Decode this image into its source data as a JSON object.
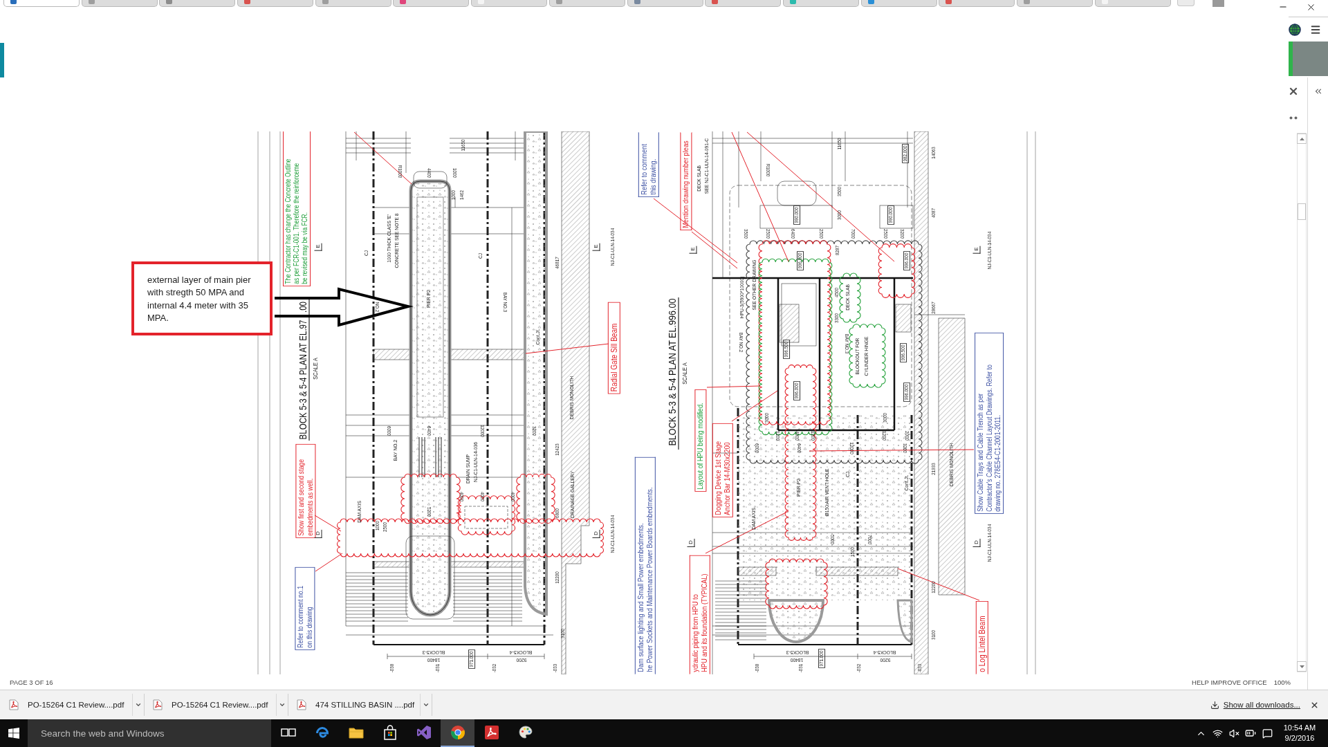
{
  "browser": {
    "tabs": [
      {
        "selected": true,
        "color": "#2a6ebb"
      },
      {
        "selected": false,
        "color": "#9e9e9e"
      },
      {
        "selected": false,
        "color": "#8d8d8d"
      },
      {
        "selected": false,
        "color": "#d9534f"
      },
      {
        "selected": false,
        "color": "#9e9e9e"
      },
      {
        "selected": false,
        "color": "#e0457b"
      },
      {
        "selected": false,
        "color": "#f4f4f4"
      },
      {
        "selected": false,
        "color": "#9e9e9e"
      },
      {
        "selected": false,
        "color": "#7a8aa0"
      },
      {
        "selected": false,
        "color": "#d9534f"
      },
      {
        "selected": false,
        "color": "#2bbbad"
      },
      {
        "selected": false,
        "color": "#2a8fd6"
      },
      {
        "selected": false,
        "color": "#d9534f"
      },
      {
        "selected": false,
        "color": "#9e9e9e"
      },
      {
        "selected": false,
        "color": "#f4f4f4"
      }
    ]
  },
  "viewer": {
    "callout": "external layer of main pier with stregth 50 MPA and internal 4.4 meter with 35 MPA.",
    "drawing": {
      "plans": [
        {
          "title": "BLOCK 5-3 & 5-4 PLAN AT EL.97",
          "title_tail": ".00",
          "scale": "SCALE A",
          "comments": [
            {
              "kind": "flagged",
              "color": "#1f9e3a",
              "lines": [
                "The Contractor has change the Concrete Outline",
                "as per FCR-C1-001. Therefore the reinforceme",
                "be revised may be via FCR."
              ]
            },
            {
              "kind": "note",
              "color": "#e3232b",
              "lines": [
                "Show first and second stage",
                "embedments as well."
              ]
            },
            {
              "kind": "note",
              "color": "#3d51a3",
              "lines": [
                "Refer to comment no.1",
                "on this drawing"
              ]
            },
            {
              "kind": "note",
              "color": "#e3232b",
              "lines": [
                "Radial Gate Sill Beam"
              ]
            }
          ],
          "labels": [
            {
              "text": "11650",
              "kind": "dimension"
            },
            {
              "text": "R1000",
              "kind": "inverted"
            },
            {
              "text": "4400",
              "kind": "inverted"
            },
            {
              "text": "1000",
              "kind": "inverted"
            },
            {
              "text": "1000",
              "kind": "dimension"
            },
            {
              "text": "1462",
              "kind": "dimension"
            },
            {
              "text": "1000 THICK CLASS 'E'",
              "kind": "note"
            },
            {
              "text": "CONCRETE SEE NOTE 8",
              "kind": "note"
            },
            {
              "text": "CJ",
              "kind": "note"
            },
            {
              "text": "CJ",
              "kind": "note"
            },
            {
              "text": "46817",
              "kind": "dimension"
            },
            {
              "text": "NO.2",
              "kind": "inverted"
            },
            {
              "text": "PIER P2",
              "kind": "note"
            },
            {
              "text": "BAY NO.3",
              "kind": "inverted"
            },
            {
              "text": "Cont.Jt.",
              "kind": "note"
            },
            {
              "text": "DEBRIS MONOLITH",
              "kind": "note"
            },
            {
              "text": "6000",
              "kind": "inverted"
            },
            {
              "text": "6400",
              "kind": "inverted"
            },
            {
              "text": "12000",
              "kind": "inverted"
            },
            {
              "text": "3200",
              "kind": "inverted"
            },
            {
              "text": "BAY NO.2",
              "kind": "note"
            },
            {
              "text": "12423",
              "kind": "dimension"
            },
            {
              "text": "DRAIN SUMP",
              "kind": "note"
            },
            {
              "text": "NJ-C1-ULN-14-036",
              "kind": "note"
            },
            {
              "text": "DRAINAGE GALLERY",
              "kind": "note"
            },
            {
              "text": "4000",
              "kind": "inverted"
            },
            {
              "text": "4000",
              "kind": "inverted"
            },
            {
              "text": "4000",
              "kind": "inverted"
            },
            {
              "text": "5200",
              "kind": "inverted"
            },
            {
              "text": "DAM AXIS",
              "kind": "note"
            },
            {
              "text": "1000",
              "kind": "dimension"
            },
            {
              "text": "2500",
              "kind": "dimension"
            },
            {
              "text": "6800",
              "kind": "dimension"
            },
            {
              "text": "12200",
              "kind": "dimension"
            },
            {
              "text": "3100",
              "kind": "dimension"
            },
            {
              "text": "BLOCK5-3",
              "kind": "reversed"
            },
            {
              "text": "18400",
              "kind": "reversed"
            },
            {
              "text": "BLOCK5-4",
              "kind": "reversed"
            },
            {
              "text": "9200",
              "kind": "reversed"
            },
            {
              "text": "971.000",
              "kind": "level"
            },
            {
              "text": "NJ-C1-ULN-14-034",
              "kind": "dimension"
            },
            {
              "text": "NJ-C1-ULN-14-034",
              "kind": "dimension"
            },
            {
              "text": "-038",
              "kind": "dimension"
            },
            {
              "text": "-031",
              "kind": "dimension"
            },
            {
              "text": "-032",
              "kind": "dimension"
            },
            {
              "text": "-033",
              "kind": "dimension"
            }
          ],
          "markers": [
            "E",
            "E",
            "D",
            "D"
          ]
        },
        {
          "title": "BLOCK 5-3 & 5-4 PLAN AT EL.996.00",
          "scale": "SCALE A",
          "comments": [
            {
              "kind": "note",
              "color": "#3d51a3",
              "lines": [
                "Refer to comment",
                "this drawing."
              ]
            },
            {
              "kind": "note",
              "color": "#e3232b",
              "lines": [
                "Mention drawing number pleas"
              ]
            },
            {
              "kind": "note",
              "color": "#3d51a3",
              "lines": [
                "Dam surface lighting and Small Power embedments.",
                "he Power Sockets and Maintenance Power Boards embedments."
              ]
            },
            {
              "kind": "flagged",
              "color": "#1f9e3a",
              "lines": [
                "Layout of HPU being modified."
              ]
            },
            {
              "kind": "note",
              "color": "#e3232b",
              "lines": [
                "Dogging Device 1st Stage",
                "Anchor Bar 14-M30x2200"
              ]
            },
            {
              "kind": "note",
              "color": "#e3232b",
              "lines": [
                "ydraulic piping from HPU to",
                "HPU and its foundation (TYPICAL)"
              ]
            },
            {
              "kind": "note",
              "color": "#3d51a3",
              "lines": [
                "Show Cable Trays and Cable Trench as per",
                "Contractor's Cable Channel Layout Drawings. Refer to",
                "drawing no. 278E54-C1-2001-2011."
              ]
            },
            {
              "kind": "note",
              "color": "#e3232b",
              "lines": [
                "o Log Lintel Beam"
              ]
            }
          ],
          "labels": [
            {
              "text": "11650",
              "kind": "dimension"
            },
            {
              "text": "R1000",
              "kind": "inverted"
            },
            {
              "text": "DECK SLAB",
              "kind": "note"
            },
            {
              "text": "SEE NJ-C1-ULN-14-091-C",
              "kind": "note"
            },
            {
              "text": "3500",
              "kind": "dimension"
            },
            {
              "text": "3000",
              "kind": "dimension"
            },
            {
              "text": "990.000",
              "kind": "level"
            },
            {
              "text": "990.000",
              "kind": "level"
            },
            {
              "text": "982.000",
              "kind": "level"
            },
            {
              "text": "14063",
              "kind": "dimension"
            },
            {
              "text": "4087",
              "kind": "dimension"
            },
            {
              "text": "3500",
              "kind": "inverted"
            },
            {
              "text": "2500",
              "kind": "inverted"
            },
            {
              "text": "6400",
              "kind": "inverted"
            },
            {
              "text": "2500",
              "kind": "inverted"
            },
            {
              "text": "7000",
              "kind": "inverted"
            },
            {
              "text": "2500",
              "kind": "inverted"
            },
            {
              "text": "3200",
              "kind": "inverted"
            },
            {
              "text": "8287",
              "kind": "dimension"
            },
            {
              "text": "996.000",
              "kind": "level"
            },
            {
              "text": "996.000",
              "kind": "level"
            },
            {
              "text": "HPU-3(5900*10000)",
              "kind": "note"
            },
            {
              "text": "SEE OTHER DRAWING",
              "kind": "note"
            },
            {
              "text": "DECK SLAB",
              "kind": "note"
            },
            {
              "text": "4500",
              "kind": "dimension"
            },
            {
              "text": "3300",
              "kind": "dimension"
            },
            {
              "text": "28667",
              "kind": "dimension"
            },
            {
              "text": "BAY NO.2",
              "kind": "inverted"
            },
            {
              "text": "996.500",
              "kind": "level"
            },
            {
              "text": "996.500",
              "kind": "level"
            },
            {
              "text": "BAY NO.3",
              "kind": "inverted"
            },
            {
              "text": "BLOCKOUT FOR",
              "kind": "note"
            },
            {
              "text": "CYLINDER HINGE",
              "kind": "note"
            },
            {
              "text": "996.000",
              "kind": "level"
            },
            {
              "text": "996.000",
              "kind": "level"
            },
            {
              "text": "3000",
              "kind": "dimension"
            },
            {
              "text": "3000",
              "kind": "dimension"
            },
            {
              "text": "1200",
              "kind": "inverted"
            },
            {
              "text": "4000",
              "kind": "inverted"
            },
            {
              "text": "1200",
              "kind": "inverted"
            },
            {
              "text": "1200",
              "kind": "inverted"
            },
            {
              "text": "2000",
              "kind": "inverted"
            },
            {
              "text": "6000",
              "kind": "inverted"
            },
            {
              "text": "6400",
              "kind": "inverted"
            },
            {
              "text": "12000",
              "kind": "inverted"
            },
            {
              "text": "3200",
              "kind": "inverted"
            },
            {
              "text": "DEBRIS MONOLITH",
              "kind": "note"
            },
            {
              "text": "21933",
              "kind": "dimension"
            },
            {
              "text": "CJ",
              "kind": "note"
            },
            {
              "text": "Cont.Jt.",
              "kind": "note"
            },
            {
              "text": "PIER P2",
              "kind": "note"
            },
            {
              "text": "Ø150 AIR VENT HOLE",
              "kind": "note"
            },
            {
              "text": "DAM AXIS",
              "kind": "note"
            },
            {
              "text": "5000",
              "kind": "inverted"
            },
            {
              "text": "7000",
              "kind": "inverted"
            },
            {
              "text": "1500",
              "kind": "dimension"
            },
            {
              "text": "12200",
              "kind": "dimension"
            },
            {
              "text": "3100",
              "kind": "dimension"
            },
            {
              "text": "BLOCK5-3",
              "kind": "reversed"
            },
            {
              "text": "18400",
              "kind": "reversed"
            },
            {
              "text": "971.000",
              "kind": "level"
            },
            {
              "text": "BLOCK5-4",
              "kind": "reversed"
            },
            {
              "text": "9200",
              "kind": "reversed"
            },
            {
              "text": "NJ-C1-ULN-14-034",
              "kind": "dimension"
            },
            {
              "text": "NJ-C1-ULN-14-034",
              "kind": "dimension"
            },
            {
              "text": "-038",
              "kind": "dimension"
            },
            {
              "text": "-031",
              "kind": "dimension"
            },
            {
              "text": "-032",
              "kind": "dimension"
            },
            {
              "text": "-033",
              "kind": "dimension"
            }
          ],
          "markers": [
            "E",
            "E",
            "D",
            "D"
          ]
        }
      ]
    },
    "status": {
      "page": "PAGE 3 OF 16",
      "feedback": "HELP IMPROVE OFFICE",
      "zoom": "100%"
    }
  },
  "downloads": {
    "items": [
      "PO-15264 C1 Review....pdf",
      "PO-15264 C1 Review....pdf",
      "474 STILLING BASIN ....pdf"
    ],
    "show_all": "Show all downloads..."
  },
  "taskbar": {
    "search": {
      "placeholder": "Search the web and Windows"
    },
    "apps": [
      {
        "kind": "taskview",
        "selected": false
      },
      {
        "kind": "edge",
        "selected": false
      },
      {
        "kind": "explorer",
        "selected": false
      },
      {
        "kind": "store",
        "selected": false
      },
      {
        "kind": "studio",
        "selected": false
      },
      {
        "kind": "chrome",
        "selected": true
      },
      {
        "kind": "acrobat",
        "selected": false
      },
      {
        "kind": "paint",
        "selected": false
      }
    ],
    "clock": {
      "time": "10:54 AM",
      "date": "9/2/2016"
    }
  }
}
